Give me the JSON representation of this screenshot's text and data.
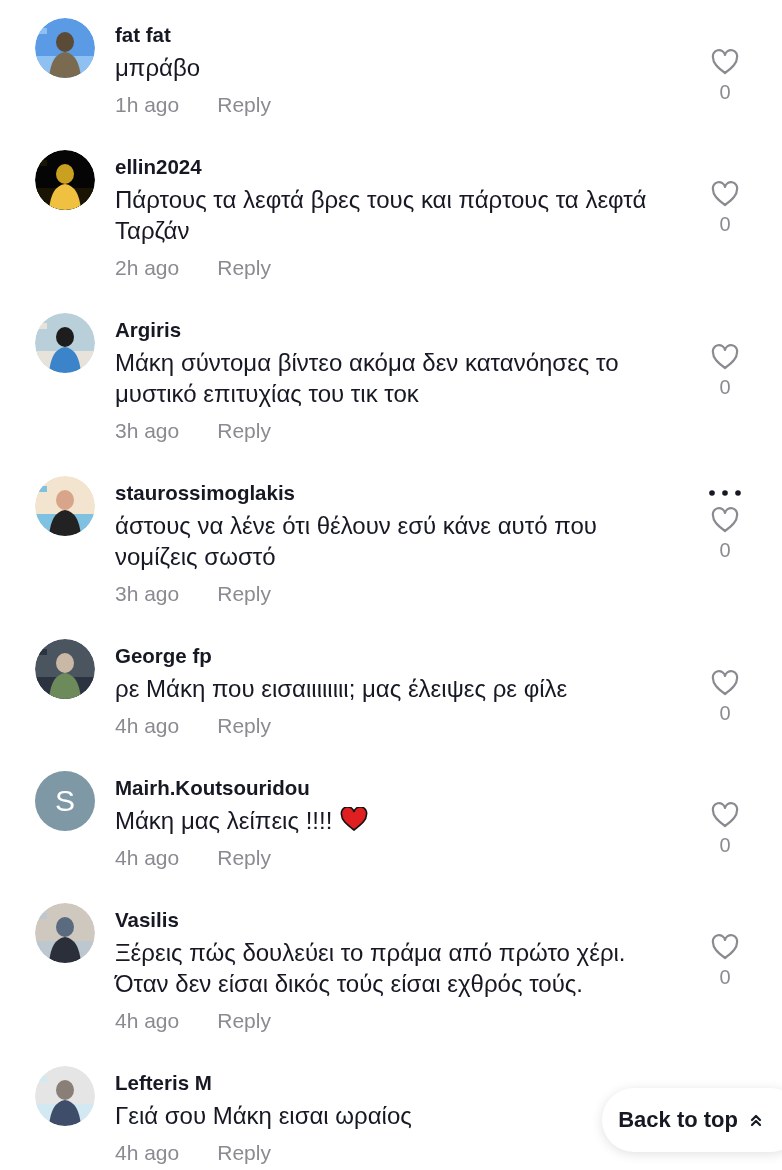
{
  "comments": [
    {
      "username": "fat fat",
      "text": "μπράβο",
      "time": "1h ago",
      "reply": "Reply",
      "likes": "0"
    },
    {
      "username": "ellin2024",
      "text": "Πάρτους τα λεφτά βρες τους και πάρτους τα λεφτά Ταρζάν",
      "time": "2h ago",
      "reply": "Reply",
      "likes": "0"
    },
    {
      "username": "Argiris",
      "text": "Μάκη σύντομα βίντεο ακόμα δεν κατανόησες το μυστικό επιτυχίας του τικ τοκ",
      "time": "3h ago",
      "reply": "Reply",
      "likes": "0"
    },
    {
      "username": "staurossimoglakis",
      "text": "άστους να λένε ότι θέλουν εσύ κάνε αυτό που νομίζεις σωστό",
      "time": "3h ago",
      "reply": "Reply",
      "likes": "0",
      "more_options": true
    },
    {
      "username": "George fp",
      "text": "ρε Μάκη που εισαιιιιιιιι; μας έλειψες ρε φίλε",
      "time": "4h ago",
      "reply": "Reply",
      "likes": "0"
    },
    {
      "avatar": {
        "kind": "letter",
        "letter": "S"
      },
      "username": "Mairh.Koutsouridou",
      "text": "Μάκη μας λείπεις !!!!",
      "time": "4h ago",
      "reply": "Reply",
      "likes": "0",
      "heart_emoji": true
    },
    {
      "username": "Vasilis",
      "text": "Ξέρεις πώς δουλεύει το πράμα από πρώτο χέρι. Όταν δεν είσαι δικός τούς είσαι εχθρός τούς.",
      "time": "4h ago",
      "reply": "Reply",
      "likes": "0"
    },
    {
      "username": "Lefteris M",
      "text": "Γειά σου Μάκη εισαι ωραίος",
      "time": "4h ago",
      "reply": "Reply"
    }
  ],
  "back_to_top": {
    "label": "Back to top"
  }
}
